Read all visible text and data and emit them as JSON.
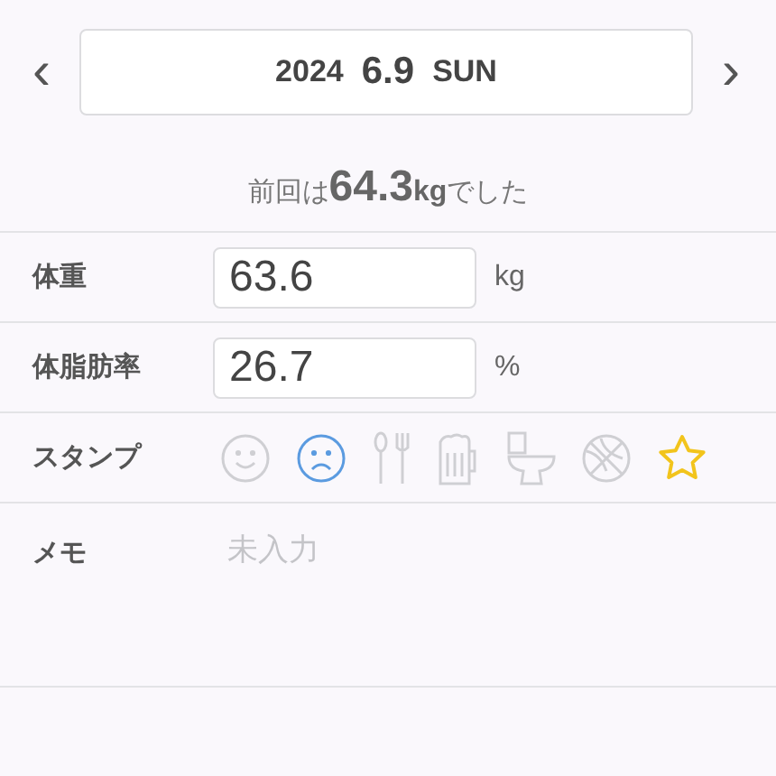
{
  "date_nav": {
    "prev": "‹",
    "next": "›",
    "year": "2024",
    "date": "6.9",
    "weekday": "SUN"
  },
  "previous": {
    "prefix": "前回は",
    "value": "64.3",
    "unit": "kg",
    "suffix": "でした"
  },
  "fields": [
    {
      "label": "体重",
      "value": "63.6",
      "unit": "kg"
    },
    {
      "label": "体脂肪率",
      "value": "26.7",
      "unit": "%"
    }
  ],
  "stamps": {
    "label": "スタンプ",
    "items": [
      {
        "kind": "smile",
        "selected": false
      },
      {
        "kind": "sad",
        "selected": true
      },
      {
        "kind": "cutlery",
        "selected": false
      },
      {
        "kind": "beer",
        "selected": false
      },
      {
        "kind": "toilet",
        "selected": false
      },
      {
        "kind": "ball",
        "selected": false
      },
      {
        "kind": "star",
        "selected": true
      }
    ]
  },
  "memo": {
    "label": "メモ",
    "placeholder": "未入力"
  }
}
